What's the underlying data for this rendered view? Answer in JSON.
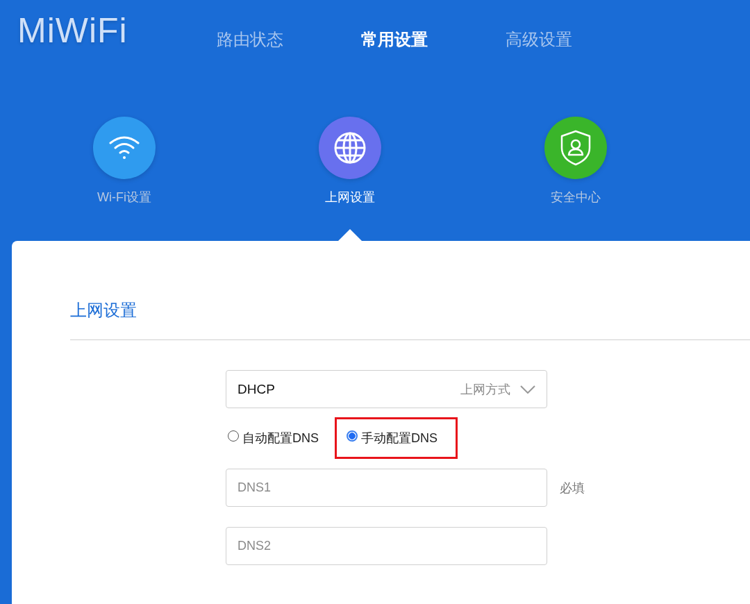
{
  "logo": "MiWiFi",
  "nav_tabs": [
    {
      "label": "路由状态",
      "selected": false
    },
    {
      "label": "常用设置",
      "selected": true
    },
    {
      "label": "高级设置",
      "selected": false
    }
  ],
  "sections": [
    {
      "label": "Wi-Fi设置",
      "kind": "wifi",
      "color": "#2f9bef",
      "selected": false
    },
    {
      "label": "上网设置",
      "kind": "globe",
      "color": "#6870ee",
      "selected": true
    },
    {
      "label": "安全中心",
      "kind": "shield",
      "color": "#3ab52a",
      "selected": false
    }
  ],
  "panel": {
    "title": "上网设置",
    "connection_select": {
      "value": "DHCP",
      "label": "上网方式"
    },
    "dns_options": [
      {
        "label": "自动配置DNS",
        "selected": false,
        "highlighted": false
      },
      {
        "label": "手动配置DNS",
        "selected": true,
        "highlighted": true
      }
    ],
    "dns_fields": [
      {
        "placeholder": "DNS1",
        "note": "必填"
      },
      {
        "placeholder": "DNS2"
      }
    ]
  }
}
